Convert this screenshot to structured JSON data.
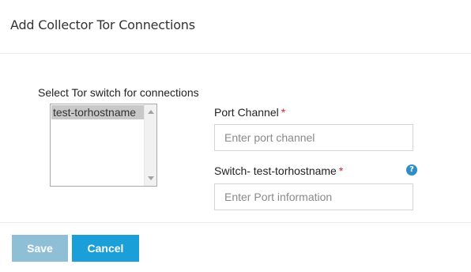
{
  "dialog": {
    "title": "Add Collector Tor Connections"
  },
  "tor_select": {
    "label": "Select Tor switch for connections",
    "options": [
      "test-torhostname"
    ],
    "selected": "test-torhostname"
  },
  "port_channel": {
    "label": "Port Channel",
    "required_marker": "*",
    "placeholder": "Enter port channel",
    "value": ""
  },
  "switch_port": {
    "label": "Switch- test-torhostname",
    "required_marker": "*",
    "placeholder": "Enter Port information",
    "value": "",
    "help_icon": "question-circle-icon"
  },
  "footer": {
    "save_label": "Save",
    "cancel_label": "Cancel"
  },
  "colors": {
    "save_button": "#8fbfd6",
    "cancel_button": "#1a9fd8",
    "required": "#d9232d",
    "help_icon": "#2f8ec6"
  }
}
